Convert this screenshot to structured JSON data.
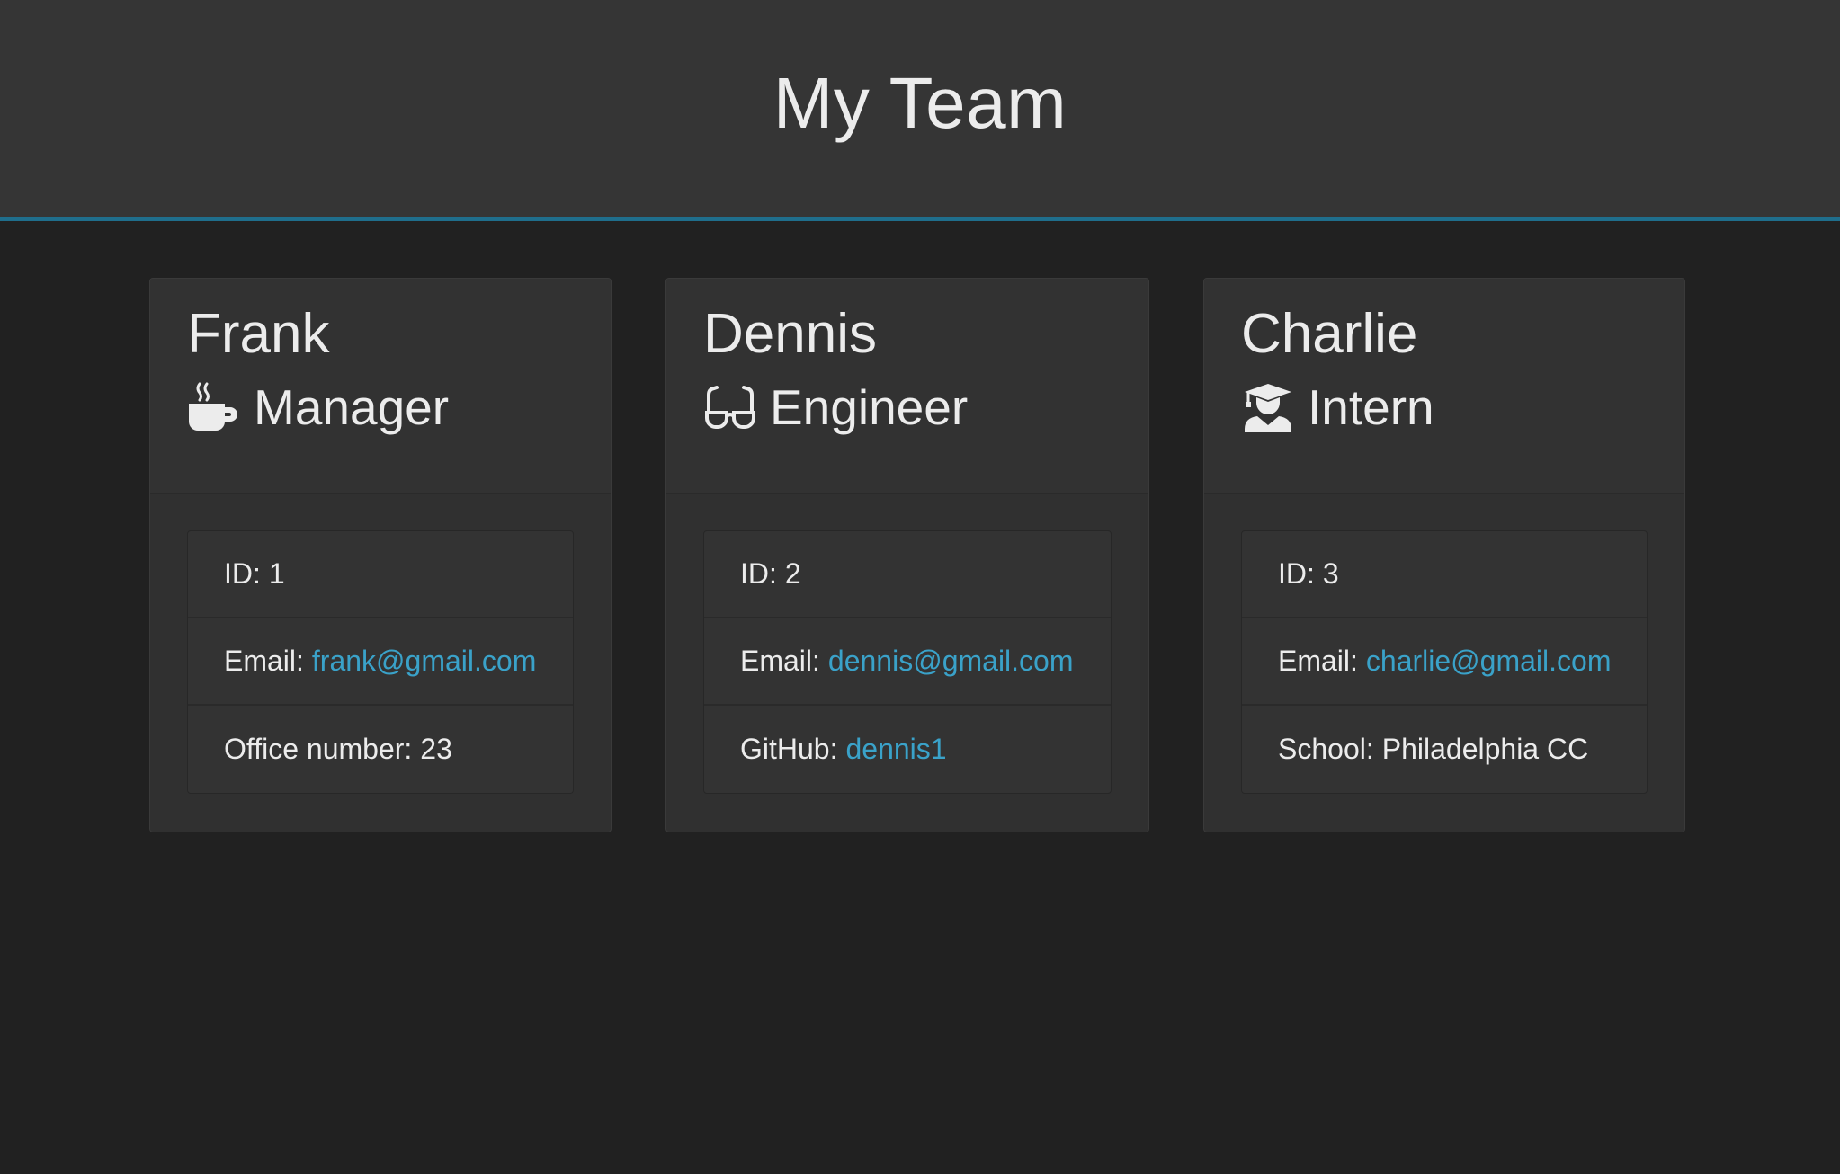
{
  "header": {
    "title": "My Team"
  },
  "colors": {
    "accent": "#1f6e8c",
    "link": "#3aa2c9",
    "background": "#212121",
    "card": "#303030"
  },
  "members": [
    {
      "name": "Frank",
      "role": "Manager",
      "icon": "coffee-mug-icon",
      "id_label": "ID:",
      "id_value": "1",
      "email_label": "Email:",
      "email": "frank@gmail.com",
      "extra_label": "Office number:",
      "extra_value": "23"
    },
    {
      "name": "Dennis",
      "role": "Engineer",
      "icon": "glasses-icon",
      "id_label": "ID:",
      "id_value": "2",
      "email_label": "Email:",
      "email": "dennis@gmail.com",
      "extra_label": "GitHub:",
      "extra_value": "dennis1"
    },
    {
      "name": "Charlie",
      "role": "Intern",
      "icon": "graduate-icon",
      "id_label": "ID:",
      "id_value": "3",
      "email_label": "Email:",
      "email": "charlie@gmail.com",
      "extra_label": "School:",
      "extra_value": "Philadelphia CC"
    }
  ]
}
